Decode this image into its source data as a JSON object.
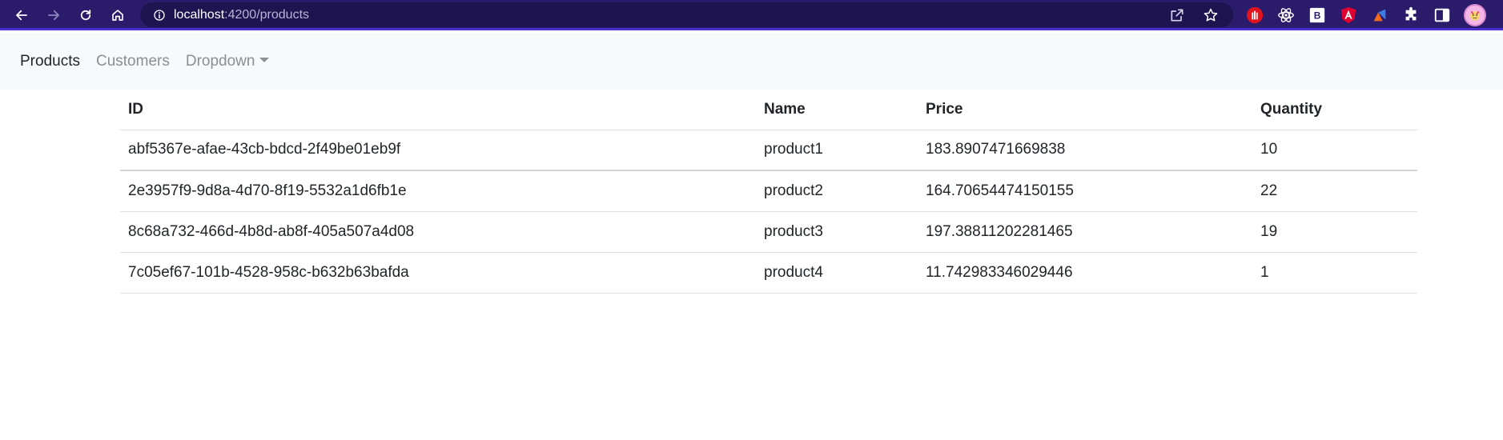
{
  "browser": {
    "url_host": "localhost",
    "url_rest": ":4200/products"
  },
  "navbar": {
    "links": [
      {
        "label": "Products",
        "active": true
      },
      {
        "label": "Customers",
        "active": false
      },
      {
        "label": "Dropdown",
        "active": false
      }
    ]
  },
  "table": {
    "headers": [
      "ID",
      "Name",
      "Price",
      "Quantity"
    ],
    "rows": [
      [
        "abf5367e-afae-43cb-bdcd-2f49be01eb9f",
        "product1",
        "183.8907471669838",
        "10"
      ],
      [
        "2e3957f9-9d8a-4d70-8f19-5532a1d6fb1e",
        "product2",
        "164.70654474150155",
        "22"
      ],
      [
        "8c68a732-466d-4b8d-ab8f-405a507a4d08",
        "product3",
        "197.38811202281465",
        "19"
      ],
      [
        "7c05ef67-101b-4528-958c-b632b63bafda",
        "product4",
        "11.742983346029446",
        "1"
      ]
    ]
  },
  "colors": {
    "chrome_bg": "#2b1b6b",
    "navbar_bg": "#f8f9fa",
    "text": "#212529",
    "muted": "#8a8f94"
  },
  "icons": [
    "back-icon",
    "forward-icon",
    "reload-icon",
    "home-icon",
    "info-icon",
    "share-icon",
    "star-icon",
    "extensions-icon",
    "sidebar-icon"
  ]
}
